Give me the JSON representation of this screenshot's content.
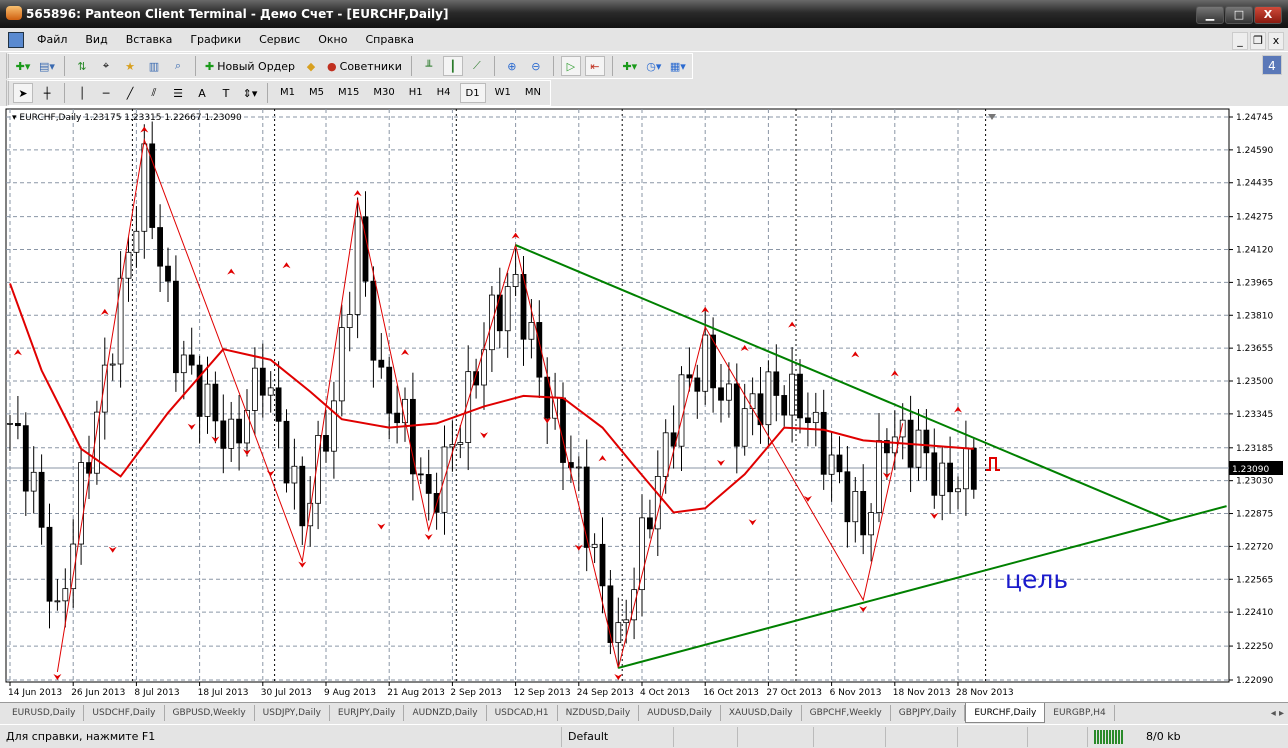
{
  "window": {
    "title": "565896: Panteon Client Terminal - Демо Счет - [EURCHF,Daily]",
    "min": "▁",
    "max": "□",
    "close": "X"
  },
  "menu": [
    "Файл",
    "Вид",
    "Вставка",
    "Графики",
    "Сервис",
    "Окно",
    "Справка"
  ],
  "mdi": {
    "min": "_",
    "restore": "❐",
    "close": "x"
  },
  "toolbar": {
    "new_order": "Новый Ордер",
    "experts": "Советники",
    "notifications": "4"
  },
  "timeframes": [
    "M1",
    "M5",
    "M15",
    "M30",
    "H1",
    "H4",
    "D1",
    "W1",
    "MN"
  ],
  "active_timeframe": "D1",
  "chart_data": {
    "type": "candlestick",
    "title": "EURCHF,Daily",
    "ohlc_header": "1.23175 1.23315 1.22667 1.23090",
    "current_price": "1.23090",
    "ylim": [
      1.2209,
      1.24745
    ],
    "y_ticks": [
      "1.24745",
      "1.24590",
      "1.24435",
      "1.24275",
      "1.24120",
      "1.23965",
      "1.23810",
      "1.23655",
      "1.23500",
      "1.23345",
      "1.23185",
      "1.23030",
      "1.22875",
      "1.22720",
      "1.22565",
      "1.22410",
      "1.22250",
      "1.22090"
    ],
    "x_ticks": [
      {
        "bar": 0,
        "label": "14 Jun 2013"
      },
      {
        "bar": 8,
        "label": "26 Jun 2013"
      },
      {
        "bar": 16,
        "label": "8 Jul 2013"
      },
      {
        "bar": 24,
        "label": "18 Jul 2013"
      },
      {
        "bar": 32,
        "label": "30 Jul 2013"
      },
      {
        "bar": 40,
        "label": "9 Aug 2013"
      },
      {
        "bar": 48,
        "label": "21 Aug 2013"
      },
      {
        "bar": 56,
        "label": "2 Sep 2013"
      },
      {
        "bar": 64,
        "label": "12 Sep 2013"
      },
      {
        "bar": 72,
        "label": "24 Sep 2013"
      },
      {
        "bar": 80,
        "label": "4 Oct 2013"
      },
      {
        "bar": 88,
        "label": "16 Oct 2013"
      },
      {
        "bar": 96,
        "label": "27 Oct 2013"
      },
      {
        "bar": 104,
        "label": "6 Nov 2013"
      },
      {
        "bar": 112,
        "label": "18 Nov 2013"
      },
      {
        "bar": 120,
        "label": "28 Nov 2013"
      }
    ],
    "bars": 123,
    "price_pivots": [
      [
        0,
        1.233
      ],
      [
        3,
        1.23
      ],
      [
        6,
        1.2235
      ],
      [
        9,
        1.23
      ],
      [
        12,
        1.235
      ],
      [
        17,
        1.245
      ],
      [
        21,
        1.2365
      ],
      [
        24,
        1.2345
      ],
      [
        28,
        1.232
      ],
      [
        32,
        1.2355
      ],
      [
        37,
        1.2285
      ],
      [
        41,
        1.234
      ],
      [
        44,
        1.242
      ],
      [
        47,
        1.2345
      ],
      [
        50,
        1.233
      ],
      [
        53,
        1.229
      ],
      [
        57,
        1.233
      ],
      [
        61,
        1.238
      ],
      [
        64,
        1.2395
      ],
      [
        68,
        1.234
      ],
      [
        72,
        1.23
      ],
      [
        75,
        1.225
      ],
      [
        77,
        1.2225
      ],
      [
        81,
        1.229
      ],
      [
        85,
        1.2345
      ],
      [
        88,
        1.236
      ],
      [
        92,
        1.233
      ],
      [
        96,
        1.2345
      ],
      [
        100,
        1.234
      ],
      [
        104,
        1.231
      ],
      [
        108,
        1.228
      ],
      [
        111,
        1.2325
      ],
      [
        115,
        1.232
      ],
      [
        118,
        1.23
      ],
      [
        122,
        1.2309
      ]
    ],
    "zigzag": [
      [
        6,
        1.22128
      ],
      [
        17,
        1.24637
      ],
      [
        37,
        1.2265
      ],
      [
        44,
        1.24354
      ],
      [
        53,
        1.22797
      ],
      [
        64,
        1.24141
      ],
      [
        77,
        1.22147
      ],
      [
        88,
        1.23755
      ],
      [
        108,
        1.22467
      ],
      [
        113,
        1.233
      ]
    ],
    "moving_average": [
      [
        0,
        1.2396
      ],
      [
        4,
        1.2355
      ],
      [
        9,
        1.2318
      ],
      [
        14,
        1.2305
      ],
      [
        20,
        1.2335
      ],
      [
        27,
        1.2365
      ],
      [
        33,
        1.236
      ],
      [
        38,
        1.2345
      ],
      [
        42,
        1.2332
      ],
      [
        48,
        1.2328
      ],
      [
        54,
        1.233
      ],
      [
        60,
        1.2338
      ],
      [
        65,
        1.2343
      ],
      [
        70,
        1.2342
      ],
      [
        75,
        1.2328
      ],
      [
        79,
        1.231
      ],
      [
        84,
        1.2288
      ],
      [
        88,
        1.229
      ],
      [
        93,
        1.2306
      ],
      [
        98,
        1.2328
      ],
      [
        103,
        1.2327
      ],
      [
        108,
        1.2322
      ],
      [
        115,
        1.232
      ],
      [
        122,
        1.2318
      ]
    ],
    "fractals_up": [
      [
        1,
        1.2365
      ],
      [
        12,
        1.2384
      ],
      [
        17,
        1.247
      ],
      [
        28,
        1.2403
      ],
      [
        35,
        1.2406
      ],
      [
        44,
        1.244
      ],
      [
        50,
        1.2365
      ],
      [
        64,
        1.242
      ],
      [
        75,
        1.2315
      ],
      [
        88,
        1.2385
      ],
      [
        93,
        1.2367
      ],
      [
        99,
        1.2378
      ],
      [
        107,
        1.2364
      ],
      [
        112,
        1.2355
      ],
      [
        120,
        1.2338
      ]
    ],
    "fractals_down": [
      [
        6,
        1.2209
      ],
      [
        13,
        1.2269
      ],
      [
        23,
        1.2327
      ],
      [
        26,
        1.2321
      ],
      [
        30,
        1.2315
      ],
      [
        33,
        1.2305
      ],
      [
        37,
        1.2262
      ],
      [
        47,
        1.228
      ],
      [
        53,
        1.2275
      ],
      [
        60,
        1.2323
      ],
      [
        68,
        1.233
      ],
      [
        72,
        1.227
      ],
      [
        77,
        1.2209
      ],
      [
        90,
        1.231
      ],
      [
        94,
        1.2282
      ],
      [
        101,
        1.2293
      ],
      [
        108,
        1.2241
      ],
      [
        111,
        1.2304
      ],
      [
        117,
        1.2285
      ]
    ],
    "trendlines": [
      {
        "color": "#008000",
        "from": [
          64,
          1.24141
        ],
        "to": [
          147,
          1.2284
        ]
      },
      {
        "color": "#008000",
        "from": [
          77,
          1.22147
        ],
        "to": [
          154,
          1.2291
        ]
      }
    ],
    "annotation": "цель"
  },
  "tabs": [
    "EURUSD,Daily",
    "USDCHF,Daily",
    "GBPUSD,Weekly",
    "USDJPY,Daily",
    "EURJPY,Daily",
    "AUDNZD,Daily",
    "USDCAD,H1",
    "NZDUSD,Daily",
    "AUDUSD,Daily",
    "XAUUSD,Daily",
    "GBPCHF,Weekly",
    "GBPJPY,Daily",
    "EURCHF,Daily",
    "EURGBP,H4"
  ],
  "active_tab": "EURCHF,Daily",
  "status": {
    "help": "Для справки, нажмите F1",
    "profile": "Default",
    "traffic": "8/0 kb"
  }
}
